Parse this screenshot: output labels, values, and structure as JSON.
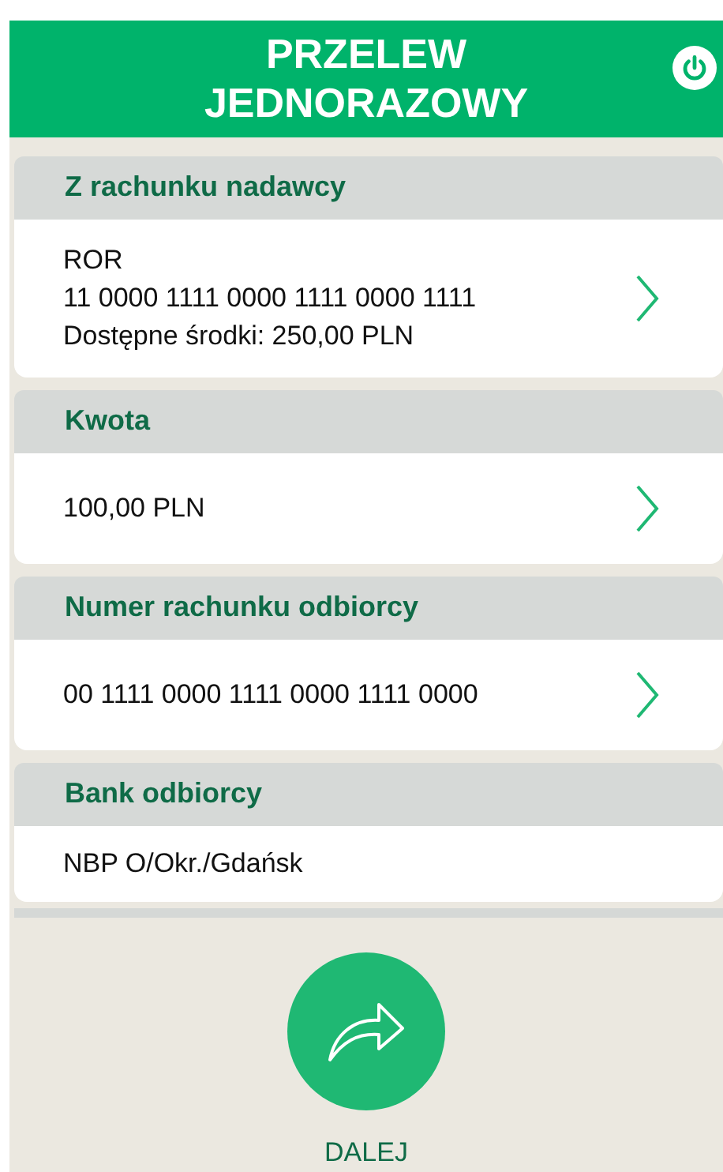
{
  "header": {
    "title_lines": [
      "PRZELEW",
      "JEDNORAZOWY"
    ]
  },
  "sections": [
    {
      "title": "Z rachunku nadawcy",
      "kind": "link",
      "lines": [
        "ROR",
        "11 0000 1111 0000 1111 0000 1111",
        "Dostępne środki: 250,00 PLN"
      ]
    },
    {
      "title": "Kwota",
      "kind": "link",
      "lines": [
        "100,00 PLN"
      ]
    },
    {
      "title": "Numer rachunku odbiorcy",
      "kind": "link",
      "lines": [
        "00 1111 0000 1111 0000 1111 0000"
      ]
    },
    {
      "title": "Bank odbiorcy",
      "kind": "info",
      "lines": [
        "NBP O/Okr./Gdańsk"
      ]
    }
  ],
  "next_button": {
    "label": "DALEJ"
  }
}
